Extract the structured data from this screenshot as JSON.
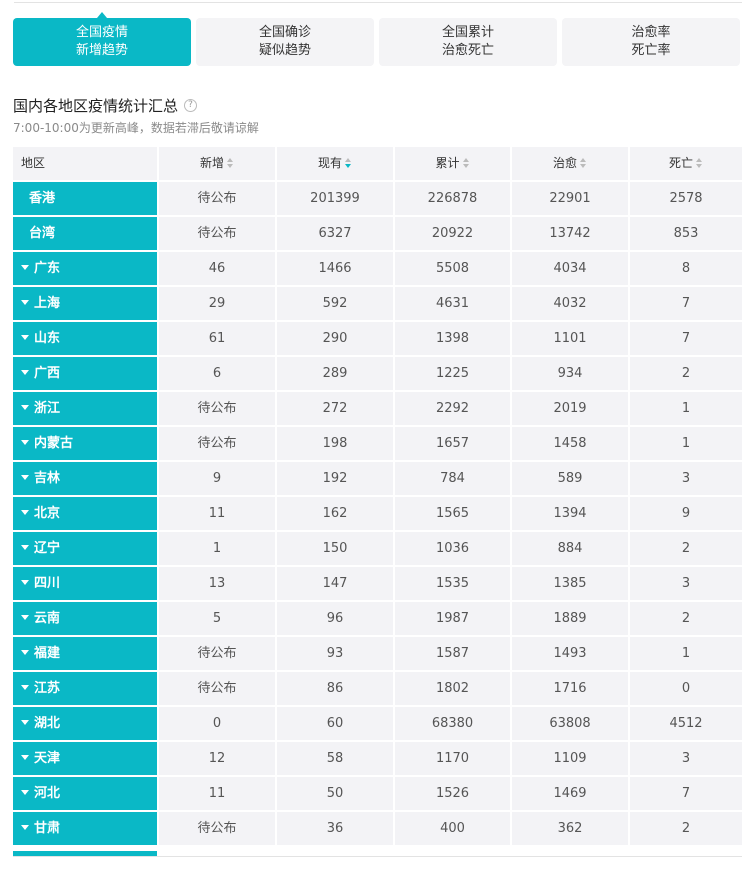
{
  "tabs": [
    {
      "line1": "全国疫情",
      "line2": "新增趋势",
      "active": true
    },
    {
      "line1": "全国确诊",
      "line2": "疑似趋势",
      "active": false
    },
    {
      "line1": "全国累计",
      "line2": "治愈死亡",
      "active": false
    },
    {
      "line1": "治愈率",
      "line2": "死亡率",
      "active": false
    }
  ],
  "section": {
    "title": "国内各地区疫情统计汇总",
    "help_glyph": "?",
    "subtitle": "7:00-10:00为更新高峰，数据若滞后敬请谅解"
  },
  "table": {
    "headers": {
      "region": "地区",
      "new": "新增",
      "current": "现有",
      "total": "累计",
      "cured": "治愈",
      "deaths": "死亡"
    },
    "active_sort": "current",
    "rows": [
      {
        "region": "香港",
        "expandable": false,
        "new": "待公布",
        "current": "201399",
        "total": "226878",
        "cured": "22901",
        "deaths": "2578"
      },
      {
        "region": "台湾",
        "expandable": false,
        "new": "待公布",
        "current": "6327",
        "total": "20922",
        "cured": "13742",
        "deaths": "853"
      },
      {
        "region": "广东",
        "expandable": true,
        "new": "46",
        "current": "1466",
        "total": "5508",
        "cured": "4034",
        "deaths": "8"
      },
      {
        "region": "上海",
        "expandable": true,
        "new": "29",
        "current": "592",
        "total": "4631",
        "cured": "4032",
        "deaths": "7"
      },
      {
        "region": "山东",
        "expandable": true,
        "new": "61",
        "current": "290",
        "total": "1398",
        "cured": "1101",
        "deaths": "7"
      },
      {
        "region": "广西",
        "expandable": true,
        "new": "6",
        "current": "289",
        "total": "1225",
        "cured": "934",
        "deaths": "2"
      },
      {
        "region": "浙江",
        "expandable": true,
        "new": "待公布",
        "current": "272",
        "total": "2292",
        "cured": "2019",
        "deaths": "1"
      },
      {
        "region": "内蒙古",
        "expandable": true,
        "new": "待公布",
        "current": "198",
        "total": "1657",
        "cured": "1458",
        "deaths": "1"
      },
      {
        "region": "吉林",
        "expandable": true,
        "new": "9",
        "current": "192",
        "total": "784",
        "cured": "589",
        "deaths": "3"
      },
      {
        "region": "北京",
        "expandable": true,
        "new": "11",
        "current": "162",
        "total": "1565",
        "cured": "1394",
        "deaths": "9"
      },
      {
        "region": "辽宁",
        "expandable": true,
        "new": "1",
        "current": "150",
        "total": "1036",
        "cured": "884",
        "deaths": "2"
      },
      {
        "region": "四川",
        "expandable": true,
        "new": "13",
        "current": "147",
        "total": "1535",
        "cured": "1385",
        "deaths": "3"
      },
      {
        "region": "云南",
        "expandable": true,
        "new": "5",
        "current": "96",
        "total": "1987",
        "cured": "1889",
        "deaths": "2"
      },
      {
        "region": "福建",
        "expandable": true,
        "new": "待公布",
        "current": "93",
        "total": "1587",
        "cured": "1493",
        "deaths": "1"
      },
      {
        "region": "江苏",
        "expandable": true,
        "new": "待公布",
        "current": "86",
        "total": "1802",
        "cured": "1716",
        "deaths": "0"
      },
      {
        "region": "湖北",
        "expandable": true,
        "new": "0",
        "current": "60",
        "total": "68380",
        "cured": "63808",
        "deaths": "4512"
      },
      {
        "region": "天津",
        "expandable": true,
        "new": "12",
        "current": "58",
        "total": "1170",
        "cured": "1109",
        "deaths": "3"
      },
      {
        "region": "河北",
        "expandable": true,
        "new": "11",
        "current": "50",
        "total": "1526",
        "cured": "1469",
        "deaths": "7"
      },
      {
        "region": "甘肃",
        "expandable": true,
        "new": "待公布",
        "current": "36",
        "total": "400",
        "cured": "362",
        "deaths": "2"
      }
    ]
  },
  "colors": {
    "accent": "#0ab8c6",
    "cell_bg": "#f3f3f6",
    "subtitle": "#8a8a8a"
  }
}
